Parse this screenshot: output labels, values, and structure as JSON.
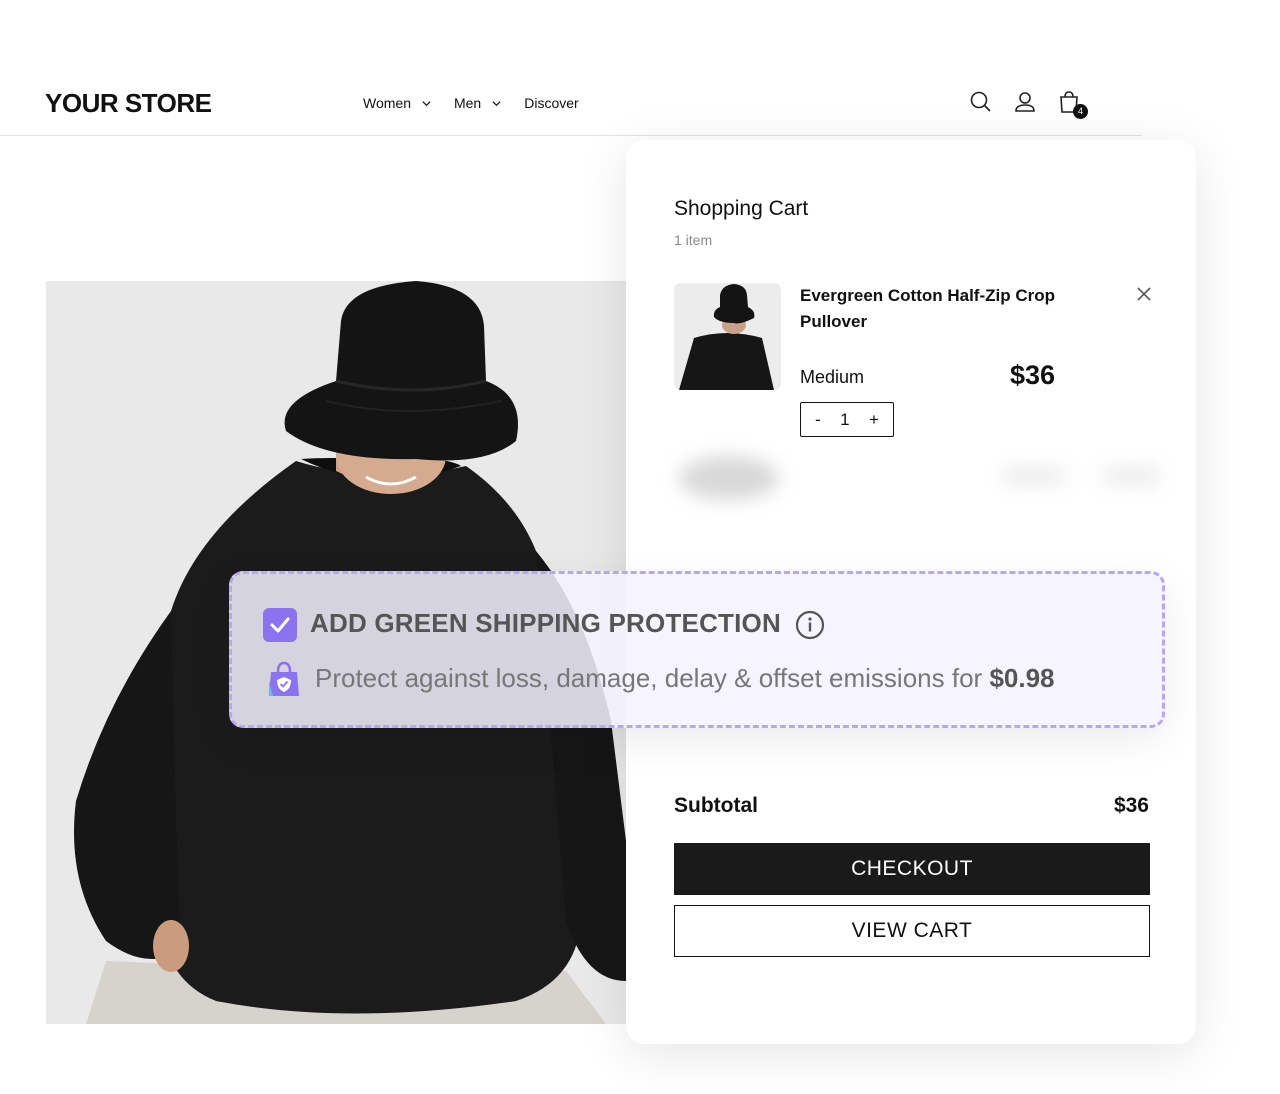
{
  "header": {
    "logo": "YOUR STORE",
    "nav": [
      {
        "label": "Women",
        "has_dropdown": true
      },
      {
        "label": "Men",
        "has_dropdown": true
      },
      {
        "label": "Discover",
        "has_dropdown": false
      }
    ],
    "icons": [
      "search-icon",
      "account-icon",
      "cart-icon"
    ],
    "cart_badge": "4"
  },
  "hero": {
    "image": "model wearing black bucket hat and black sweatshirt"
  },
  "cart": {
    "title": "Shopping Cart",
    "count": "1 item",
    "item": {
      "name": "Evergreen Cotton Half-Zip Crop Pullover",
      "variant": "Medium",
      "price": "$36",
      "quantity": "1",
      "minus": "-",
      "plus": "+"
    },
    "subtotal_label": "Subtotal",
    "subtotal_value": "$36",
    "checkout_label": "CHECKOUT",
    "view_cart_label": "VIEW CART"
  },
  "protection": {
    "checked": true,
    "title": "ADD GREEN SHIPPING PROTECTION",
    "description": "Protect against loss, damage, delay & offset emissions for",
    "price": "$0.98",
    "accent": "#8b72ee"
  }
}
